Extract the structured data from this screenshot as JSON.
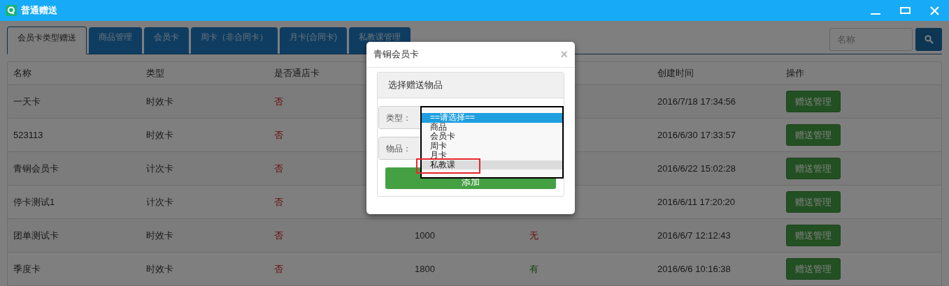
{
  "window": {
    "title": "普通赠送"
  },
  "tabs": [
    {
      "label": "会员卡类型赠送",
      "selected": true
    },
    {
      "label": "商品管理",
      "selected": false
    },
    {
      "label": "会员卡",
      "selected": false
    },
    {
      "label": "周卡（非合同卡）",
      "selected": false
    },
    {
      "label": "月卡(合同卡)",
      "selected": false
    },
    {
      "label": "私教课管理",
      "selected": false
    }
  ],
  "search": {
    "placeholder": "名称"
  },
  "table": {
    "columns": [
      "名称",
      "类型",
      "是否通店卡",
      null,
      null,
      "创建时间",
      "操作"
    ],
    "rows": [
      {
        "cells": [
          "一天卡",
          "时效卡",
          "否",
          null,
          null,
          "2016/7/18 17:34:56"
        ],
        "action": "赠送管理"
      },
      {
        "cells": [
          "523113",
          "时效卡",
          "否",
          null,
          null,
          "2016/6/30 17:33:57"
        ],
        "action": "赠送管理"
      },
      {
        "cells": [
          "青铜会员卡",
          "计次卡",
          "否",
          null,
          null,
          "2016/6/22 15:02:28"
        ],
        "action": "赠送管理"
      },
      {
        "cells": [
          "停卡测试1",
          "计次卡",
          "否",
          null,
          null,
          "2016/6/11 17:20:20"
        ],
        "action": "赠送管理"
      },
      {
        "cells": [
          "团单测试卡",
          "时效卡",
          "否",
          "1000",
          "无",
          "2016/6/7 12:12:43"
        ],
        "action": "赠送管理"
      },
      {
        "cells": [
          "季度卡",
          "时效卡",
          "否",
          "1800",
          "有",
          "2016/6/6 10:16:38"
        ],
        "action": "赠送管理"
      }
    ]
  },
  "dialog": {
    "title": "青铜会员卡",
    "close": "×",
    "panel_title": "选择赠送物品",
    "type_label": "类型：",
    "item_label": "物品：",
    "add_button": "添加",
    "options": [
      {
        "label": "==请选择==",
        "selected": true,
        "hovered": false,
        "outlined": false
      },
      {
        "label": "商品",
        "selected": false,
        "hovered": false,
        "outlined": false
      },
      {
        "label": "会员卡",
        "selected": false,
        "hovered": false,
        "outlined": false
      },
      {
        "label": "周卡",
        "selected": false,
        "hovered": false,
        "outlined": false
      },
      {
        "label": "月卡",
        "selected": false,
        "hovered": false,
        "outlined": false
      },
      {
        "label": "私教课",
        "selected": false,
        "hovered": true,
        "outlined": true
      }
    ]
  }
}
